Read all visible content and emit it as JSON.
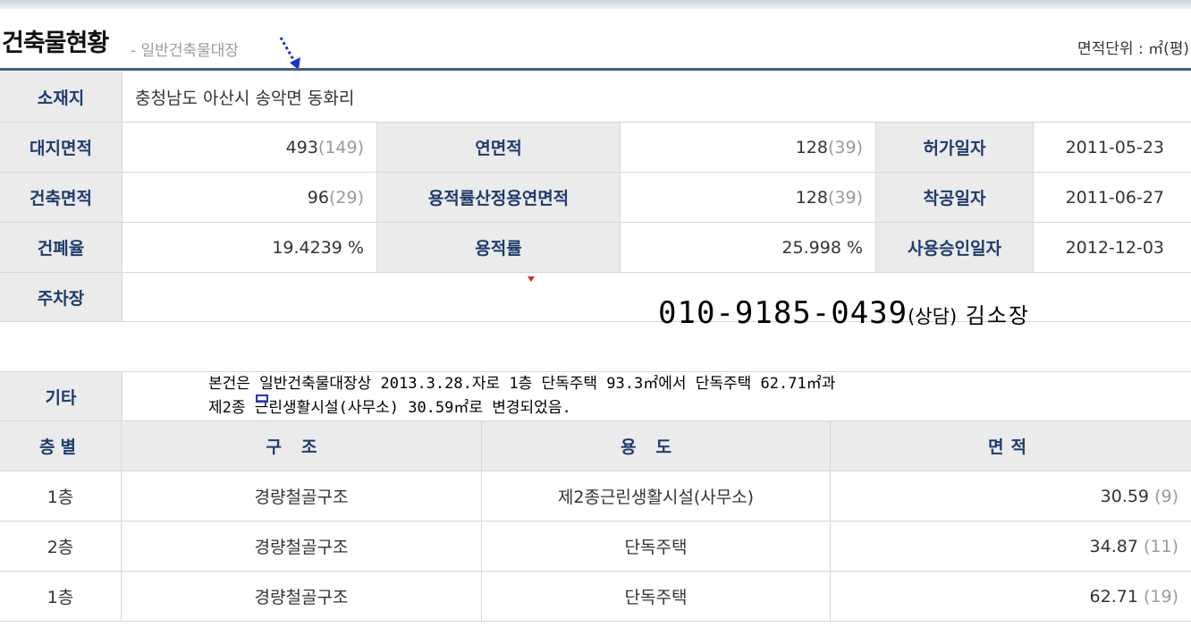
{
  "header": {
    "title": "건축물현황",
    "subtitle": "- 일반건축물대장",
    "unit_label": "면적단위 : ㎡(평)"
  },
  "location": {
    "label": "소재지",
    "value": "충청남도 아산시 송악면 동화리"
  },
  "info_rows": [
    {
      "l1": "대지면적",
      "v1": "493",
      "p1": "(149)",
      "l2": "연면적",
      "v2": "128",
      "p2": "(39)",
      "l3": "허가일자",
      "v3": "2011-05-23"
    },
    {
      "l1": "건축면적",
      "v1": "96",
      "p1": "(29)",
      "l2": "용적률산정용연면적",
      "v2": "128",
      "p2": "(39)",
      "l3": "착공일자",
      "v3": "2011-06-27"
    },
    {
      "l1": "건폐율",
      "v1": "19.4239 %",
      "p1": "",
      "l2": "용적률",
      "v2": "25.998 %",
      "p2": "",
      "l3": "사용승인일자",
      "v3": "2012-12-03"
    }
  ],
  "parking": {
    "label": "주차장"
  },
  "contact": {
    "phone": "010-9185-0439",
    "tag": "(상담)",
    "name": " 김소장"
  },
  "other": {
    "label": "기타",
    "line1": "본건은 일반건축물대장상 2013.3.28.자로 1층 단독주택 93.3㎡에서 단독주택 62.71㎡과",
    "line2": "제2종 근린생활시설(사무소) 30.59㎡로 변경되었음."
  },
  "floors_table": {
    "headers": [
      "층별",
      "구조",
      "용도",
      "면적"
    ],
    "rows": [
      {
        "floor": "1층",
        "structure": "경량철골구조",
        "use": "제2종근린생활시설(사무소)",
        "area": "30.59",
        "pyeong": "(9)"
      },
      {
        "floor": "2층",
        "structure": "경량철골구조",
        "use": "단독주택",
        "area": "34.87",
        "pyeong": "(11)"
      },
      {
        "floor": "1층",
        "structure": "경량철골구조",
        "use": "단독주택",
        "area": "62.71",
        "pyeong": "(19)"
      }
    ]
  },
  "colors": {
    "label_text": "#1d3b6e",
    "label_bg": "#ebebeb",
    "rule": "#3f607f",
    "arrow": "#1a2fd6"
  }
}
